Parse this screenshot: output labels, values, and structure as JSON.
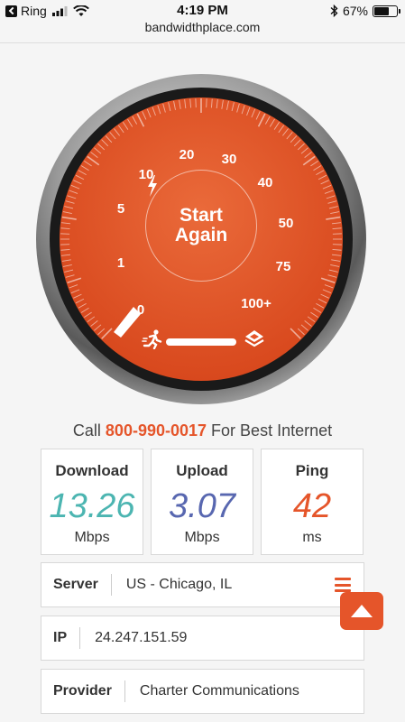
{
  "status_bar": {
    "carrier": "Ring",
    "time": "4:19 PM",
    "battery_percent": "67%",
    "battery_level": 0.67
  },
  "browser": {
    "url": "bandwidthplace.com"
  },
  "gauge": {
    "labels": [
      "0",
      "1",
      "5",
      "10",
      "20",
      "30",
      "40",
      "50",
      "75",
      "100+"
    ],
    "button_line1": "Start",
    "button_line2": "Again",
    "colors": {
      "orange": "#e5552a",
      "dial_dark": "#1a1a1a"
    }
  },
  "call": {
    "prefix": "Call",
    "phone": "800-990-0017",
    "suffix": "For Best Internet"
  },
  "stats": [
    {
      "title": "Download",
      "value": "13.26",
      "unit": "Mbps",
      "color": "#4cb5b1"
    },
    {
      "title": "Upload",
      "value": "3.07",
      "unit": "Mbps",
      "color": "#5867b0"
    },
    {
      "title": "Ping",
      "value": "42",
      "unit": "ms",
      "color": "#e5552a"
    }
  ],
  "info": {
    "server_label": "Server",
    "server_value": "US - Chicago, IL",
    "ip_label": "IP",
    "ip_value": "24.247.151.59",
    "provider_label": "Provider",
    "provider_value": "Charter Communications"
  }
}
